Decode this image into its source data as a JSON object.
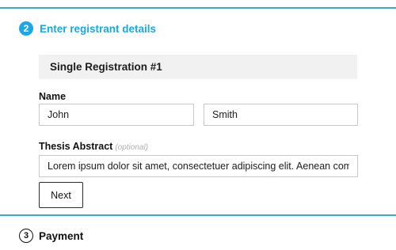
{
  "colors": {
    "accent": "#1aa9e6",
    "divider": "#35a9d8",
    "panel": "#f1f1f1"
  },
  "steps": {
    "registrant": {
      "number": "2",
      "title": "Enter registrant details",
      "state": "active"
    },
    "payment": {
      "number": "3",
      "title": "Payment",
      "state": "inactive"
    }
  },
  "registration": {
    "heading": "Single Registration #1",
    "name_label": "Name",
    "first_name_value": "John",
    "last_name_value": "Smith",
    "abstract_label": "Thesis Abstract",
    "abstract_optional": "(optional)",
    "abstract_value": "Lorem ipsum dolor sit amet, consectetuer adipiscing elit. Aenean commo",
    "next_label": "Next"
  }
}
